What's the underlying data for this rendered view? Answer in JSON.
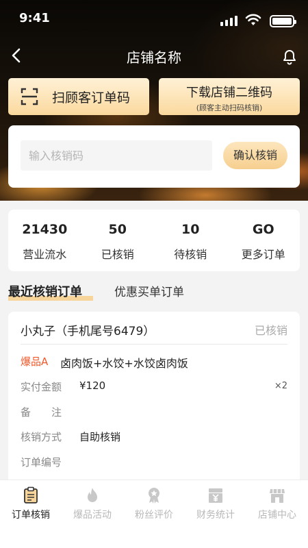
{
  "status_bar": {
    "time": "9:41"
  },
  "nav": {
    "title": "店铺名称"
  },
  "actions": {
    "scan_label": "扫顾客订单码",
    "qr_label": "下载店铺二维码",
    "qr_sublabel": "(顾客主动扫码核销)"
  },
  "verify": {
    "placeholder": "输入核销码",
    "confirm_label": "确认核销"
  },
  "stats": [
    {
      "value": "21430",
      "label": "营业流水"
    },
    {
      "value": "50",
      "label": "已核销"
    },
    {
      "value": "10",
      "label": "待核销"
    },
    {
      "value": "GO",
      "label": "更多订单"
    }
  ],
  "section_tabs": {
    "active": "最近核销订单",
    "inactive": "优惠买单订单"
  },
  "order": {
    "customer": "小丸子（手机尾号6479）",
    "status": "已核销",
    "product_tag": "爆品A",
    "product_name": "卤肉饭+水饺+水饺卤肉饭",
    "paid_label": "实付金额",
    "paid_value": "¥120",
    "quantity": "×2",
    "remark_label": "备　　注",
    "method_label": "核销方式",
    "method_value": "自助核销",
    "order_no_label": "订单编号"
  },
  "tabbar": [
    {
      "label": "订单核销",
      "icon": "order-verify-icon",
      "active": true
    },
    {
      "label": "爆品活动",
      "icon": "flame-icon",
      "active": false
    },
    {
      "label": "粉丝评价",
      "icon": "badge-icon",
      "active": false
    },
    {
      "label": "财务统计",
      "icon": "yen-icon",
      "active": false
    },
    {
      "label": "店铺中心",
      "icon": "store-icon",
      "active": false
    }
  ],
  "colors": {
    "accent_gold": "#f6d49a",
    "button_gold_light": "#fff1d6",
    "button_gold_dark": "#fbd99e",
    "tag_red": "#f0582a",
    "inactive_gray": "#b8b8b8"
  }
}
